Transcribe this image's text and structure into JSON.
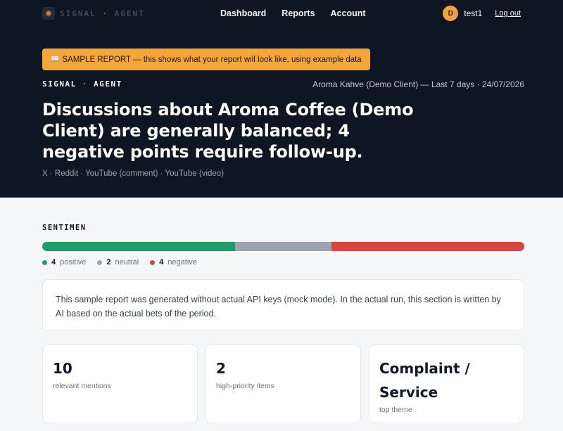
{
  "nav": {
    "brand": {
      "word1": "SIGNAL",
      "sep": "·",
      "word2": "AGENT"
    },
    "links": [
      "Dashboard",
      "Reports",
      "Account"
    ],
    "user": {
      "initial": "D",
      "name": "test1",
      "logout": "Log out"
    }
  },
  "banner": {
    "icon": "book-icon",
    "text": "SAMPLE REPORT — this shows what your report will look like, using example data"
  },
  "report": {
    "eyebrow": {
      "word1": "SIGNAL",
      "sep": "·",
      "word2": "AGENT"
    },
    "meta": "Aroma Kahve (Demo Client) — Last 7 days · 24/07/2026",
    "headline": "Discussions about Aroma Coffee (Demo Client) are generally balanced; 4 negative points require follow-up.",
    "sources": "X · Reddit · YouTube (comment) · YouTube (video)"
  },
  "sentiment": {
    "title": "SENTIMEN",
    "positive": {
      "count": "4",
      "label": "positive",
      "share": 4
    },
    "neutral": {
      "count": "2",
      "label": "neutral",
      "share": 2
    },
    "negative": {
      "count": "4",
      "label": "negative",
      "share": 4
    }
  },
  "summary": "This sample report was generated without actual API keys (mock mode). In the actual run, this section is written by AI based on the actual bets of the period.",
  "stats": [
    {
      "value": "10",
      "label": "relevant mentions"
    },
    {
      "value": "2",
      "label": "high-priority items"
    },
    {
      "value": "Complaint / Service",
      "label": "top theme"
    }
  ],
  "colors": {
    "positive": "#1f9d6b",
    "neutral": "#9ca3af",
    "negative": "#d9463e",
    "accent": "#f4a636",
    "hero_bg": "#0f1623"
  }
}
